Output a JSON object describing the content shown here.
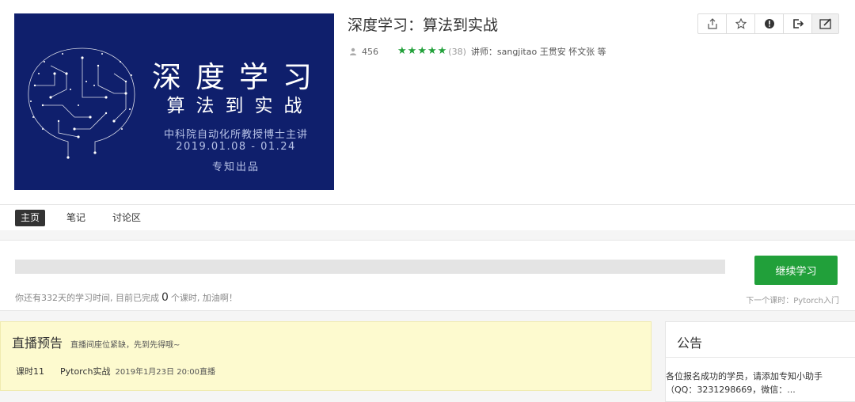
{
  "cover": {
    "title": "深度学习",
    "subtitle": "算法到实战",
    "line1": "中科院自动化所教授博士主讲",
    "line2": "2019.01.08 - 01.24",
    "line3": "专知出品"
  },
  "course": {
    "title": "深度学习：算法到实战",
    "student_count": "456",
    "rating_stars": 5,
    "rating_count": "(38)",
    "teacher": "讲师：sangjitao 王贯安 怀文张 等"
  },
  "toolbar": {
    "icons": [
      "share-icon",
      "star-icon",
      "info-icon",
      "exit-icon",
      "edit-icon"
    ]
  },
  "tabs": [
    {
      "label": "主页",
      "active": true
    },
    {
      "label": "笔记",
      "active": false
    },
    {
      "label": "讨论区",
      "active": false
    }
  ],
  "progress": {
    "fraction": 0,
    "text_before": "你还有332天的学习时间, 目前已完成",
    "completed": "0",
    "text_after": "个课时, 加油啊！",
    "continue_label": "继续学习",
    "next_lesson": "下一个课时：Pytorch入门"
  },
  "live": {
    "title": "直播预告",
    "note": "直播间座位紧缺，先到先得哦~",
    "lesson_no": "课时11",
    "lesson_name": "Pytorch实战",
    "lesson_time": "2019年1月23日 20:00直播"
  },
  "notice": {
    "title": "公告",
    "line1": "各位报名成功的学员，请添加专知小助手",
    "line2": "（QQ：3231298669，微信：..."
  },
  "colors": {
    "accent": "#21a03a",
    "cover_bg": "#0f1f6c",
    "live_bg": "#fdfacf"
  }
}
